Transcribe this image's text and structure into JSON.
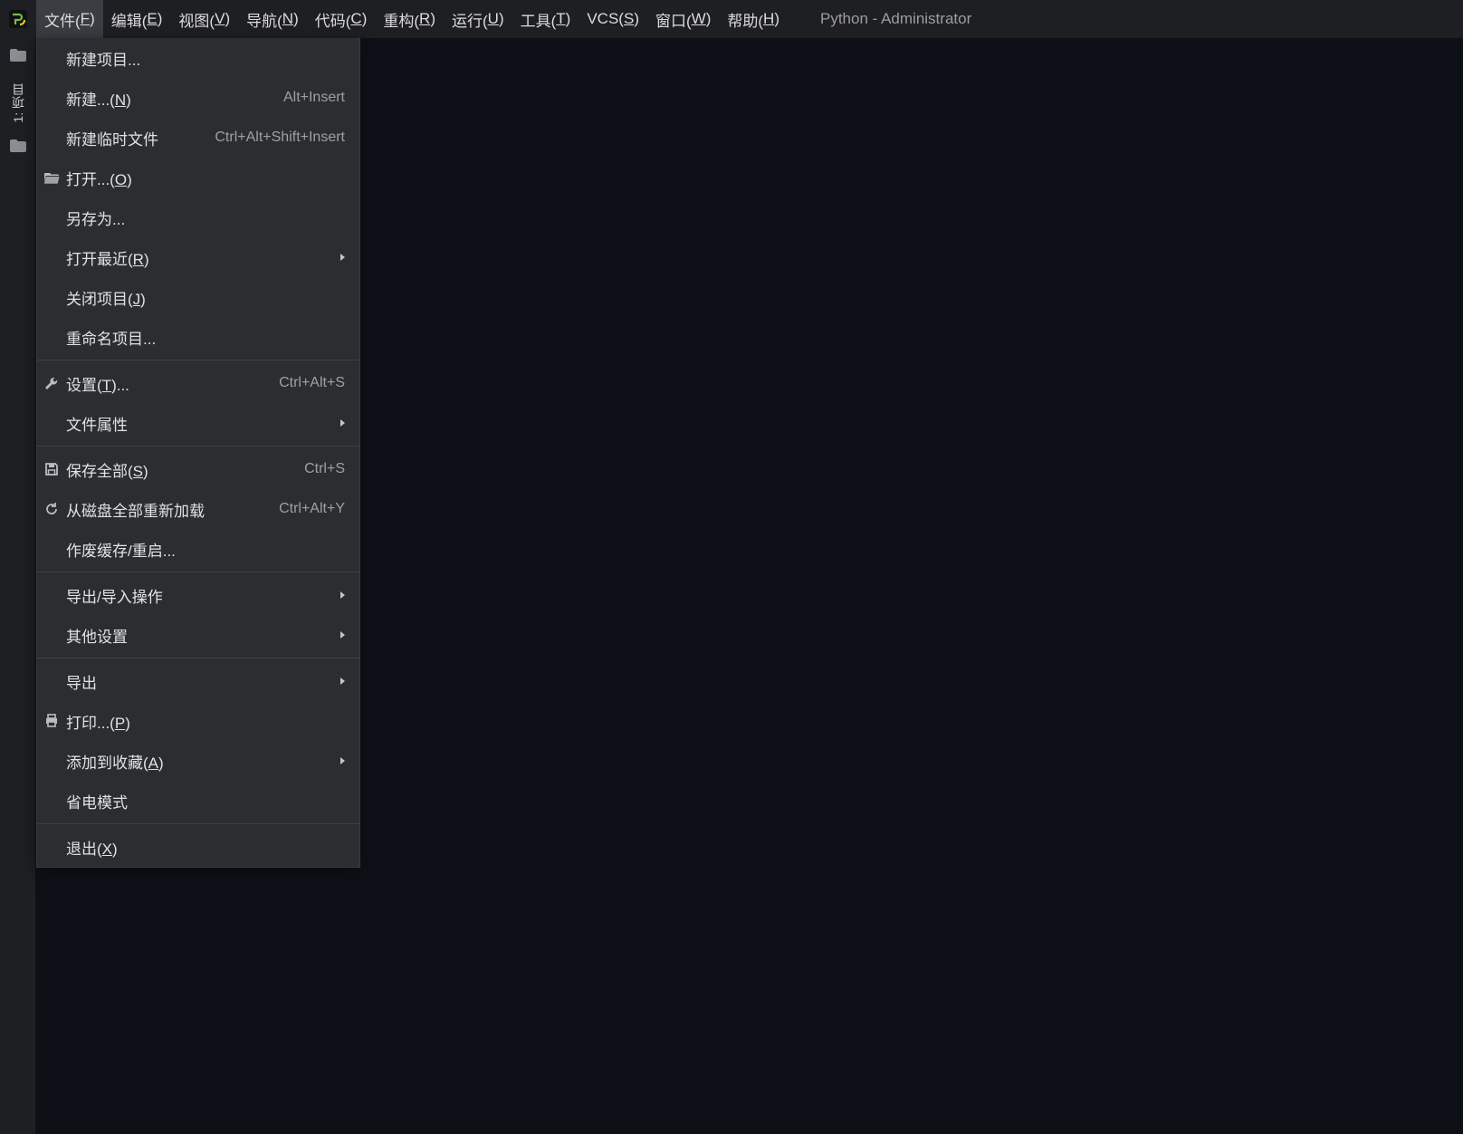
{
  "window_title": "Python - Administrator",
  "menubar": {
    "items": [
      {
        "text": "文件",
        "mnemonic": "F"
      },
      {
        "text": "编辑",
        "mnemonic": "E"
      },
      {
        "text": "视图",
        "mnemonic": "V"
      },
      {
        "text": "导航",
        "mnemonic": "N"
      },
      {
        "text": "代码",
        "mnemonic": "C"
      },
      {
        "text": "重构",
        "mnemonic": "R"
      },
      {
        "text": "运行",
        "mnemonic": "U"
      },
      {
        "text": "工具",
        "mnemonic": "T"
      },
      {
        "text": "VCS",
        "mnemonic": "S"
      },
      {
        "text": "窗口",
        "mnemonic": "W"
      },
      {
        "text": "帮助",
        "mnemonic": "H"
      }
    ]
  },
  "sidebar_tab": {
    "label": "1: 项目"
  },
  "file_menu": {
    "groups": [
      [
        {
          "label": "新建项目...",
          "icon": "",
          "shortcut": "",
          "submenu": false,
          "mnemonic": ""
        },
        {
          "label": "新建...",
          "icon": "",
          "shortcut": "Alt+Insert",
          "submenu": false,
          "mnemonic": "N"
        },
        {
          "label": "新建临时文件",
          "icon": "",
          "shortcut": "Ctrl+Alt+Shift+Insert",
          "submenu": false,
          "mnemonic": ""
        },
        {
          "label": "打开...",
          "icon": "folder-open",
          "shortcut": "",
          "submenu": false,
          "mnemonic": "O"
        },
        {
          "label": "另存为...",
          "icon": "",
          "shortcut": "",
          "submenu": false,
          "mnemonic": ""
        },
        {
          "label": "打开最近",
          "icon": "",
          "shortcut": "",
          "submenu": true,
          "mnemonic": "R"
        },
        {
          "label": "关闭项目",
          "icon": "",
          "shortcut": "",
          "submenu": false,
          "mnemonic": "J"
        },
        {
          "label": "重命名项目...",
          "icon": "",
          "shortcut": "",
          "submenu": false,
          "mnemonic": ""
        }
      ],
      [
        {
          "label": "设置",
          "icon": "wrench",
          "shortcut": "Ctrl+Alt+S",
          "submenu": false,
          "mnemonic": "T",
          "suffix": "..."
        },
        {
          "label": "文件属性",
          "icon": "",
          "shortcut": "",
          "submenu": true,
          "mnemonic": ""
        }
      ],
      [
        {
          "label": "保存全部",
          "icon": "save",
          "shortcut": "Ctrl+S",
          "submenu": false,
          "mnemonic": "S"
        },
        {
          "label": "从磁盘全部重新加载",
          "icon": "reload",
          "shortcut": "Ctrl+Alt+Y",
          "submenu": false,
          "mnemonic": ""
        },
        {
          "label": "作废缓存/重启...",
          "icon": "",
          "shortcut": "",
          "submenu": false,
          "mnemonic": ""
        }
      ],
      [
        {
          "label": "导出/导入操作",
          "icon": "",
          "shortcut": "",
          "submenu": true,
          "mnemonic": ""
        },
        {
          "label": "其他设置",
          "icon": "",
          "shortcut": "",
          "submenu": true,
          "mnemonic": ""
        }
      ],
      [
        {
          "label": "导出",
          "icon": "",
          "shortcut": "",
          "submenu": true,
          "mnemonic": ""
        },
        {
          "label": "打印...",
          "icon": "print",
          "shortcut": "",
          "submenu": false,
          "mnemonic": "P"
        },
        {
          "label": "添加到收藏",
          "icon": "",
          "shortcut": "",
          "submenu": true,
          "mnemonic": "A"
        },
        {
          "label": "省电模式",
          "icon": "",
          "shortcut": "",
          "submenu": false,
          "mnemonic": ""
        }
      ],
      [
        {
          "label": "退出",
          "icon": "",
          "shortcut": "",
          "submenu": false,
          "mnemonic": "X"
        }
      ]
    ]
  }
}
